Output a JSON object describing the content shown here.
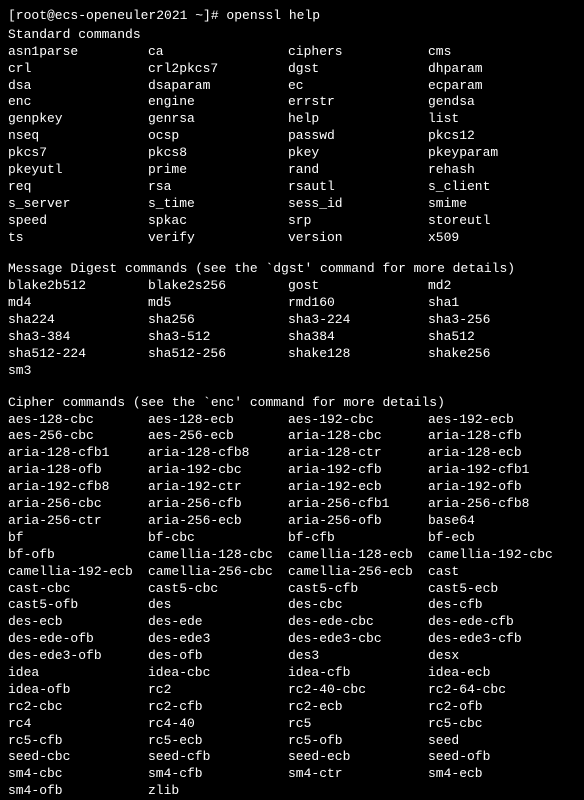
{
  "prompt": "[root@ecs-openeuler2021 ~]# openssl help",
  "sections": [
    {
      "header": "Standard commands",
      "rows": [
        [
          "asn1parse",
          "ca",
          "ciphers",
          "cms"
        ],
        [
          "crl",
          "crl2pkcs7",
          "dgst",
          "dhparam"
        ],
        [
          "dsa",
          "dsaparam",
          "ec",
          "ecparam"
        ],
        [
          "enc",
          "engine",
          "errstr",
          "gendsa"
        ],
        [
          "genpkey",
          "genrsa",
          "help",
          "list"
        ],
        [
          "nseq",
          "ocsp",
          "passwd",
          "pkcs12"
        ],
        [
          "pkcs7",
          "pkcs8",
          "pkey",
          "pkeyparam"
        ],
        [
          "pkeyutl",
          "prime",
          "rand",
          "rehash"
        ],
        [
          "req",
          "rsa",
          "rsautl",
          "s_client"
        ],
        [
          "s_server",
          "s_time",
          "sess_id",
          "smime"
        ],
        [
          "speed",
          "spkac",
          "srp",
          "storeutl"
        ],
        [
          "ts",
          "verify",
          "version",
          "x509"
        ]
      ]
    },
    {
      "header": "Message Digest commands (see the `dgst' command for more details)",
      "rows": [
        [
          "blake2b512",
          "blake2s256",
          "gost",
          "md2"
        ],
        [
          "md4",
          "md5",
          "rmd160",
          "sha1"
        ],
        [
          "sha224",
          "sha256",
          "sha3-224",
          "sha3-256"
        ],
        [
          "sha3-384",
          "sha3-512",
          "sha384",
          "sha512"
        ],
        [
          "sha512-224",
          "sha512-256",
          "shake128",
          "shake256"
        ],
        [
          "sm3",
          "",
          "",
          ""
        ]
      ]
    },
    {
      "header": "Cipher commands (see the `enc' command for more details)",
      "rows": [
        [
          "aes-128-cbc",
          "aes-128-ecb",
          "aes-192-cbc",
          "aes-192-ecb"
        ],
        [
          "aes-256-cbc",
          "aes-256-ecb",
          "aria-128-cbc",
          "aria-128-cfb"
        ],
        [
          "aria-128-cfb1",
          "aria-128-cfb8",
          "aria-128-ctr",
          "aria-128-ecb"
        ],
        [
          "aria-128-ofb",
          "aria-192-cbc",
          "aria-192-cfb",
          "aria-192-cfb1"
        ],
        [
          "aria-192-cfb8",
          "aria-192-ctr",
          "aria-192-ecb",
          "aria-192-ofb"
        ],
        [
          "aria-256-cbc",
          "aria-256-cfb",
          "aria-256-cfb1",
          "aria-256-cfb8"
        ],
        [
          "aria-256-ctr",
          "aria-256-ecb",
          "aria-256-ofb",
          "base64"
        ],
        [
          "bf",
          "bf-cbc",
          "bf-cfb",
          "bf-ecb"
        ],
        [
          "bf-ofb",
          "camellia-128-cbc",
          "camellia-128-ecb",
          "camellia-192-cbc"
        ],
        [
          "camellia-192-ecb",
          "camellia-256-cbc",
          "camellia-256-ecb",
          "cast"
        ],
        [
          "cast-cbc",
          "cast5-cbc",
          "cast5-cfb",
          "cast5-ecb"
        ],
        [
          "cast5-ofb",
          "des",
          "des-cbc",
          "des-cfb"
        ],
        [
          "des-ecb",
          "des-ede",
          "des-ede-cbc",
          "des-ede-cfb"
        ],
        [
          "des-ede-ofb",
          "des-ede3",
          "des-ede3-cbc",
          "des-ede3-cfb"
        ],
        [
          "des-ede3-ofb",
          "des-ofb",
          "des3",
          "desx"
        ],
        [
          "idea",
          "idea-cbc",
          "idea-cfb",
          "idea-ecb"
        ],
        [
          "idea-ofb",
          "rc2",
          "rc2-40-cbc",
          "rc2-64-cbc"
        ],
        [
          "rc2-cbc",
          "rc2-cfb",
          "rc2-ecb",
          "rc2-ofb"
        ],
        [
          "rc4",
          "rc4-40",
          "rc5",
          "rc5-cbc"
        ],
        [
          "rc5-cfb",
          "rc5-ecb",
          "rc5-ofb",
          "seed"
        ],
        [
          "seed-cbc",
          "seed-cfb",
          "seed-ecb",
          "seed-ofb"
        ],
        [
          "sm4-cbc",
          "sm4-cfb",
          "sm4-ctr",
          "sm4-ecb"
        ],
        [
          "sm4-ofb",
          "zlib",
          "",
          ""
        ]
      ]
    }
  ]
}
